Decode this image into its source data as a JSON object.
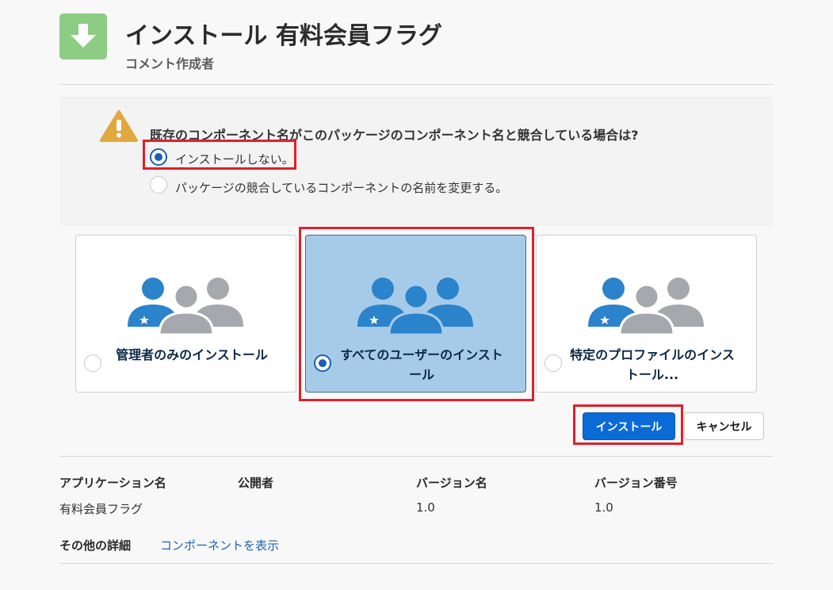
{
  "header": {
    "icon": "download-arrow-icon",
    "icon_color": "#8ccc83",
    "title": "インストール 有料会員フラグ",
    "subtitle": "コメント作成者"
  },
  "conflict": {
    "icon": "warning-icon",
    "question": "既存のコンポーネント名がこのパッケージのコンポーネント名と競合している場合は?",
    "options": [
      {
        "label": "インストールしない。",
        "checked": true
      },
      {
        "label": "パッケージの競合しているコンポーネントの名前を変更する。",
        "checked": false
      }
    ]
  },
  "install_targets": [
    {
      "label": "管理者のみのインストール",
      "selected": false,
      "icon": "admin-users-icon"
    },
    {
      "label": "すべてのユーザーのインストール",
      "selected": true,
      "icon": "all-users-icon"
    },
    {
      "label": "特定のプロファイルのインストール...",
      "selected": false,
      "icon": "profile-users-icon"
    }
  ],
  "actions": {
    "install_label": "インストール",
    "cancel_label": "キャンセル"
  },
  "package_info": {
    "headers": [
      "アプリケーション名",
      "公開者",
      "バージョン名",
      "バージョン番号"
    ],
    "values": [
      "有料会員フラグ",
      "",
      "1.0",
      "1.0"
    ],
    "details_label": "その他の詳細",
    "details_link": "コンポーネントを表示"
  },
  "colors": {
    "accent": "#0a6bd6",
    "highlight": "#e0202a",
    "selected_card": "#a6cbe8",
    "user_blue": "#2b83cc",
    "user_gray": "#a5a8ad"
  }
}
